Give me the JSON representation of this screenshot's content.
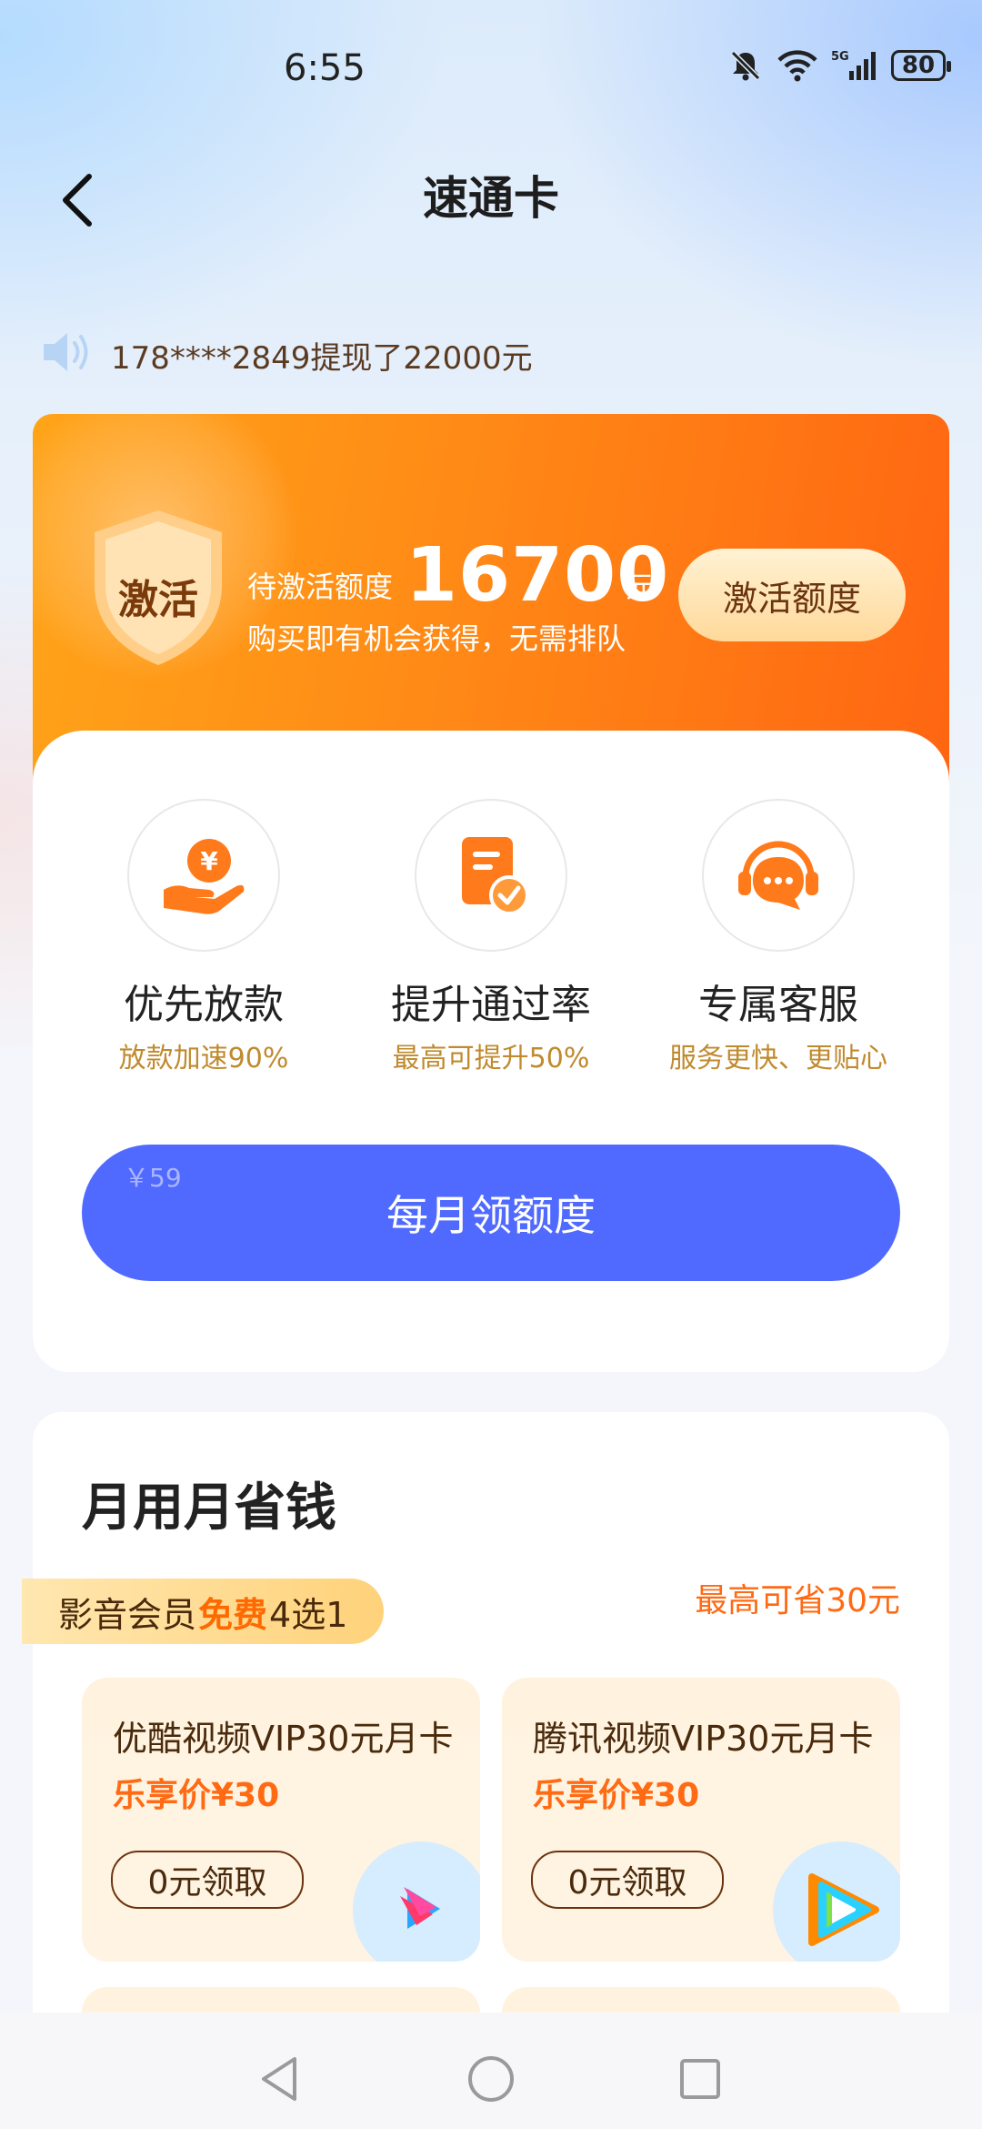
{
  "status_bar": {
    "time": "6:55",
    "battery": "80",
    "network": "5G"
  },
  "header": {
    "title": "速通卡"
  },
  "ticker": {
    "text": "178****2849提现了22000元"
  },
  "activation": {
    "badge": "激活",
    "pending_label": "待激活额度",
    "pending_amount": "16700",
    "unit": "元",
    "subtitle": "购买即有机会获得，无需排队",
    "button": "激活额度"
  },
  "benefits": [
    {
      "title": "优先放款",
      "sub": "放款加速90%",
      "icon": "yuan-hand-icon"
    },
    {
      "title": "提升通过率",
      "sub": "最高可提升50%",
      "icon": "document-check-icon"
    },
    {
      "title": "专属客服",
      "sub": "服务更快、更贴心",
      "icon": "headset-chat-icon"
    }
  ],
  "monthly": {
    "price": "￥59",
    "button": "每月领额度"
  },
  "savings": {
    "title": "月用月省钱",
    "tag_prefix": "影音会员",
    "tag_free": "免费",
    "tag_suffix": "4选1",
    "max_save": "最高可省30元",
    "cards": [
      {
        "name": "优酷视频VIP30元月卡",
        "price": "乐享价¥30",
        "claim": "0元领取",
        "icon": "youku-logo-icon"
      },
      {
        "name": "腾讯视频VIP30元月卡",
        "price": "乐享价¥30",
        "claim": "0元领取",
        "icon": "tencent-video-logo-icon"
      }
    ]
  },
  "colors": {
    "accent_blue": "#5069ff",
    "orange": "#ff6a13",
    "gold_text": "#c08a2e"
  }
}
